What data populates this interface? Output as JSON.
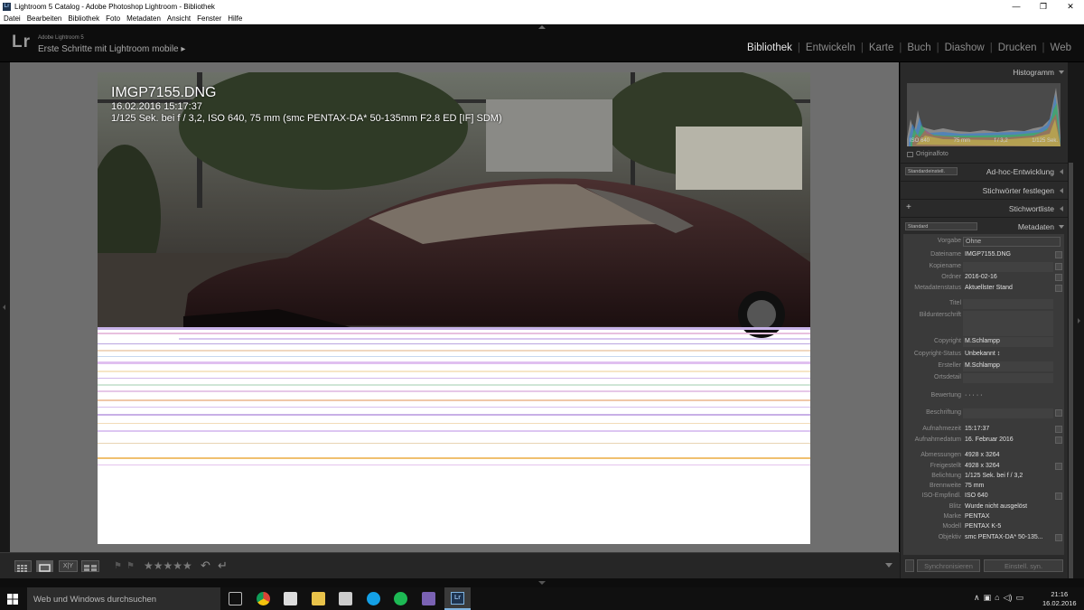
{
  "window": {
    "title": "Lightroom 5 Catalog - Adobe Photoshop Lightroom - Bibliothek",
    "controls": [
      "—",
      "❐",
      "✕"
    ]
  },
  "menu": [
    "Datei",
    "Bearbeiten",
    "Bibliothek",
    "Foto",
    "Metadaten",
    "Ansicht",
    "Fenster",
    "Hilfe"
  ],
  "header": {
    "logo": "Lr",
    "brand": "Adobe Lightroom 5",
    "get_started": "Erste Schritte mit Lightroom mobile ▸",
    "modules": [
      {
        "label": "Bibliothek",
        "active": true
      },
      {
        "label": "Entwickeln",
        "active": false
      },
      {
        "label": "Karte",
        "active": false
      },
      {
        "label": "Buch",
        "active": false
      },
      {
        "label": "Diashow",
        "active": false
      },
      {
        "label": "Drucken",
        "active": false
      },
      {
        "label": "Web",
        "active": false
      }
    ]
  },
  "photo": {
    "filename": "IMGP7155.DNG",
    "datetime": "16.02.2016 15:17:37",
    "exif": "1/125 Sek. bei f / 3,2, ISO 640, 75 mm (smc PENTAX-DA* 50-135mm F2.8 ED [IF] SDM)"
  },
  "toolbar": {
    "view_buttons": [
      "grid",
      "loupe",
      "compare",
      "survey"
    ],
    "compare_label": "X|Y",
    "stars": "★★★★★",
    "rotate_left": "↶",
    "rotate_right": "↵"
  },
  "panels": {
    "histogram": {
      "title": "Histogramm",
      "iso": "ISO 640",
      "focal": "75 mm",
      "aperture": "f / 3,2",
      "shutter": "1/125 Sek.",
      "original_label": "Originalfoto"
    },
    "quick_develop": {
      "title": "Ad-hoc-Entwicklung",
      "preset": "Standardeinstell."
    },
    "keywording": {
      "title": "Stichwörter festlegen"
    },
    "keyword_list": {
      "title": "Stichwortliste",
      "add": "+"
    },
    "metadata": {
      "title": "Metadaten",
      "preset_select": "Standard",
      "preset_label": "Vorgabe",
      "preset_value": "Ohne",
      "rows": [
        {
          "label": "Dateiname",
          "value": "IMGP7155.DNG"
        },
        {
          "label": "Kopiename",
          "value": ""
        },
        {
          "label": "Ordner",
          "value": "2016-02-16"
        },
        {
          "label": "Metadatenstatus",
          "value": "Aktuellster Stand"
        },
        {
          "label": "Titel",
          "value": ""
        },
        {
          "label": "Bildunterschrift",
          "value": ""
        },
        {
          "label": "Copyright",
          "value": "M.Schlampp"
        },
        {
          "label": "Copyright-Status",
          "value": "Unbekannt ↕"
        },
        {
          "label": "Ersteller",
          "value": "M.Schlampp"
        },
        {
          "label": "Ortsdetail",
          "value": ""
        },
        {
          "label": "Bewertung",
          "value": "· · · · ·"
        },
        {
          "label": "Beschriftung",
          "value": ""
        },
        {
          "label": "Aufnahmezeit",
          "value": "15:17:37"
        },
        {
          "label": "Aufnahmedatum",
          "value": "16. Februar 2016"
        },
        {
          "label": "Abmessungen",
          "value": "4928 x 3264"
        },
        {
          "label": "Freigestellt",
          "value": "4928 x 3264"
        },
        {
          "label": "Belichtung",
          "value": "1/125 Sek. bei f / 3,2"
        },
        {
          "label": "Brennweite",
          "value": "75 mm"
        },
        {
          "label": "ISO-Empfindl.",
          "value": "ISO 640"
        },
        {
          "label": "Blitz",
          "value": "Wurde nicht ausgelöst"
        },
        {
          "label": "Marke",
          "value": "PENTAX"
        },
        {
          "label": "Modell",
          "value": "PENTAX K-5"
        },
        {
          "label": "Objektiv",
          "value": "smc PENTAX-DA* 50-135..."
        }
      ]
    },
    "sync_button": "Synchronisieren",
    "sync_settings_button": "Einstell. syn."
  },
  "taskbar": {
    "search_placeholder": "Web und Windows durchsuchen",
    "time": "21:16",
    "date": "16.02.2016",
    "tray_arrow": "∧"
  }
}
